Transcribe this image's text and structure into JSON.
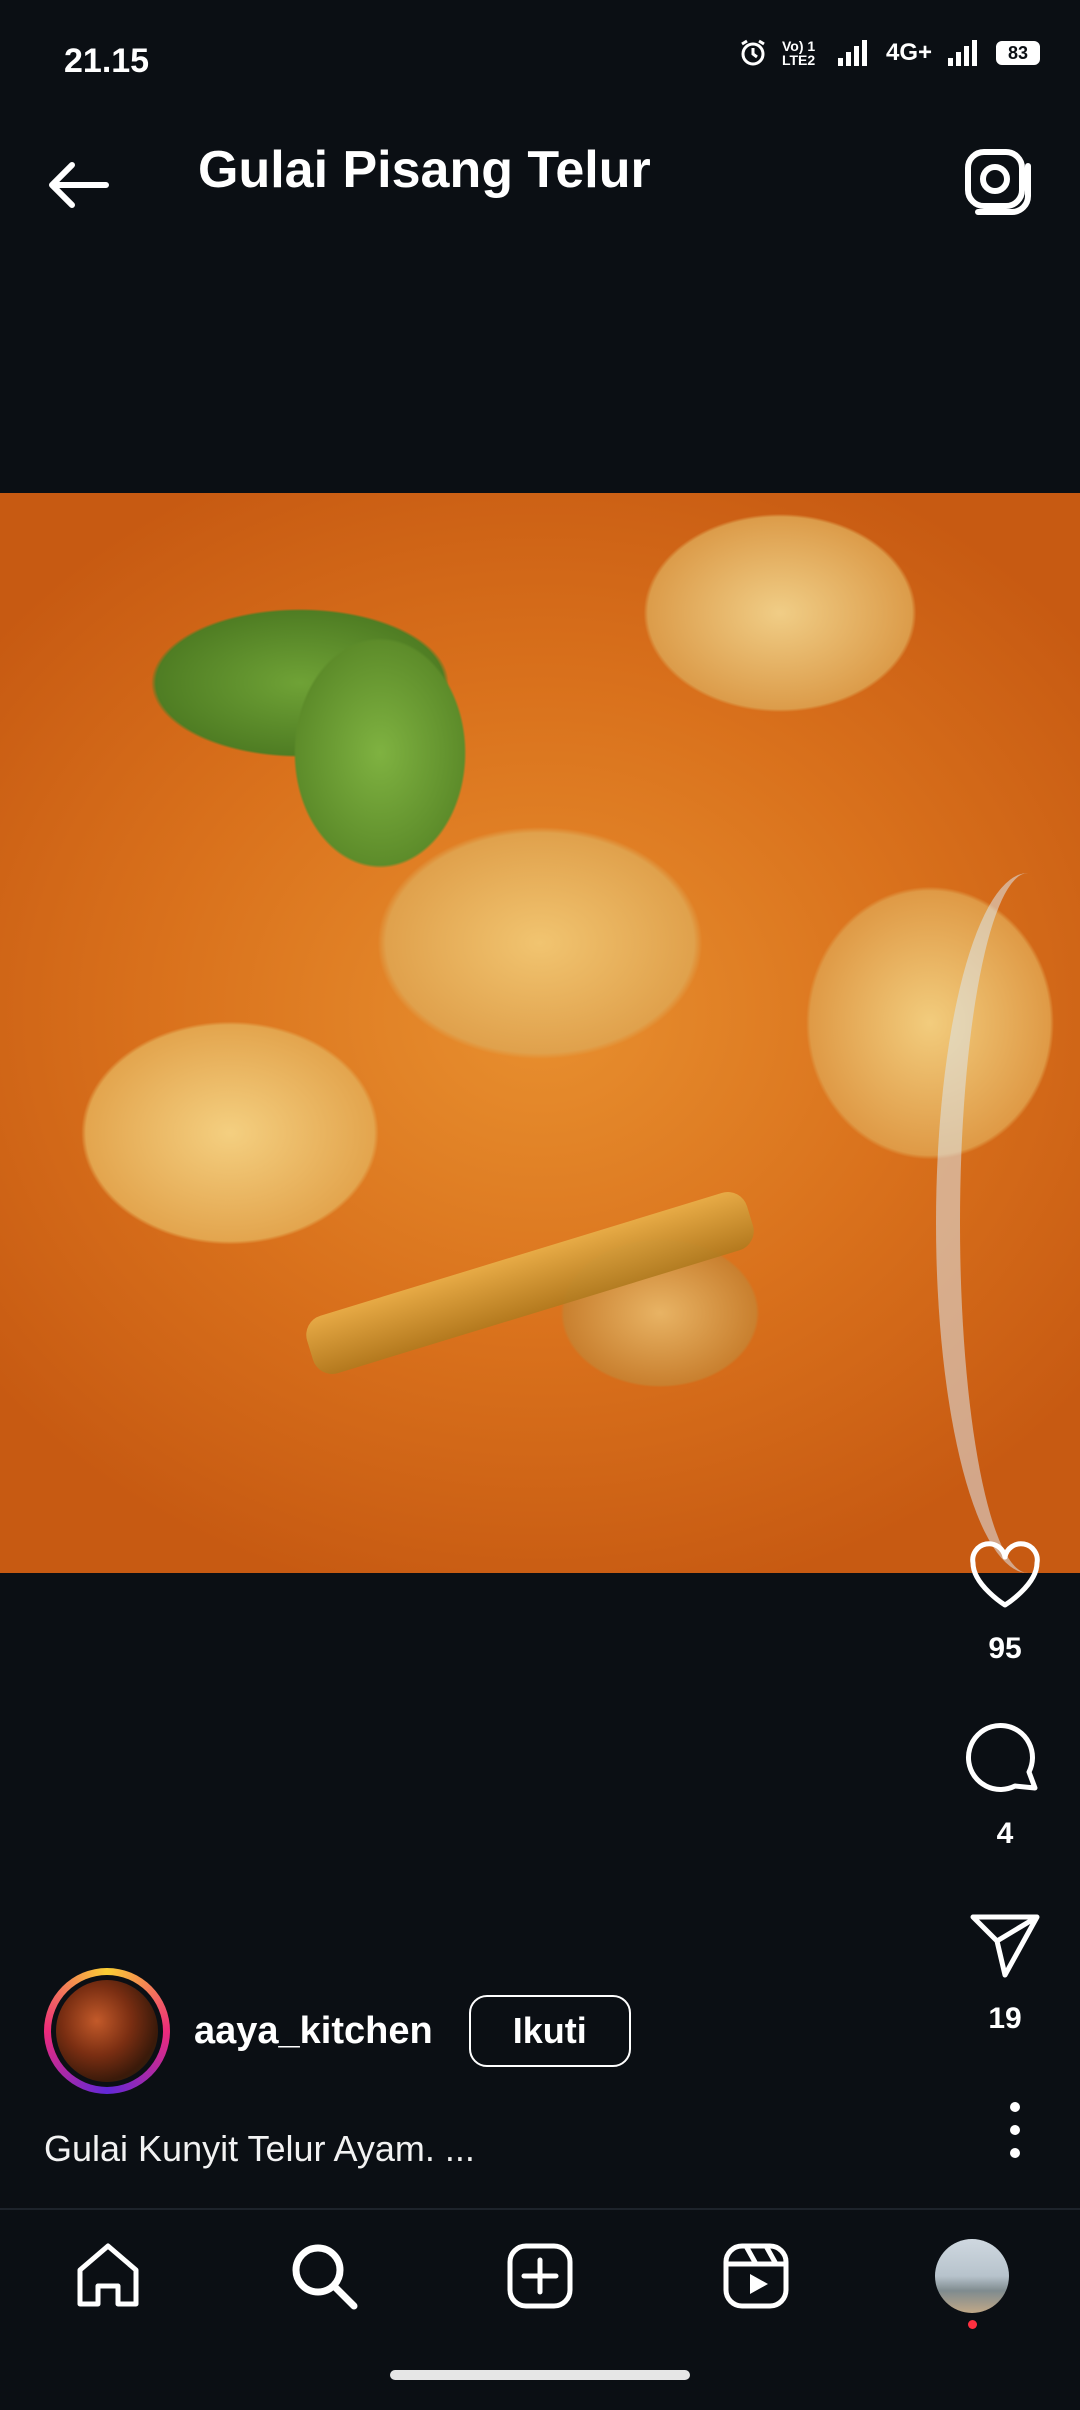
{
  "status_bar": {
    "time": "21.15",
    "network_label": "4G+",
    "volte_label": "Vo) 1 LTE2",
    "battery": "83"
  },
  "header": {
    "title": "Gulai Pisang Telur",
    "back_icon": "arrow-left-icon",
    "camera_icon": "camera-icon"
  },
  "post": {
    "image": "curry-dish-photo",
    "author": {
      "username": "aaya_kitchen",
      "follow_label": "Ikuti"
    },
    "caption": "Gulai Kunyit Telur Ayam. ..."
  },
  "actions": {
    "likes": "95",
    "comments": "4",
    "shares": "19"
  },
  "bottom_nav": {
    "items": [
      "home-icon",
      "search-icon",
      "create-icon",
      "reels-icon",
      "profile-avatar"
    ],
    "notification_color": "#ff3040"
  },
  "colors": {
    "background": "#0b0f14",
    "text": "#ffffff"
  }
}
